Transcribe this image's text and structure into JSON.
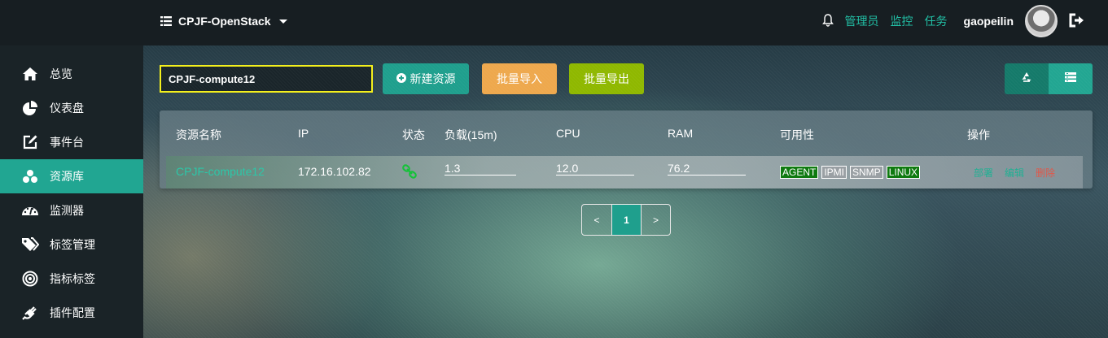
{
  "header": {
    "project_name": "CPJF-OpenStack",
    "links": [
      "管理员",
      "监控",
      "任务"
    ],
    "username": "gaopeilin"
  },
  "sidebar": {
    "items": [
      {
        "label": "总览",
        "icon": "home-icon"
      },
      {
        "label": "仪表盘",
        "icon": "pie-chart-icon"
      },
      {
        "label": "事件台",
        "icon": "edit-icon"
      },
      {
        "label": "资源库",
        "icon": "cubes-icon",
        "active": true
      },
      {
        "label": "监测器",
        "icon": "dashboard-icon"
      },
      {
        "label": "标签管理",
        "icon": "tags-icon"
      },
      {
        "label": "指标标签",
        "icon": "target-icon"
      },
      {
        "label": "插件配置",
        "icon": "plug-icon"
      }
    ]
  },
  "toolbar": {
    "search_value": "CPJF-compute12",
    "new_label": "新建资源",
    "import_label": "批量导入",
    "export_label": "批量导出",
    "icon_buttons": [
      "recycle-icon",
      "list-icon"
    ]
  },
  "table": {
    "headers": [
      "资源名称",
      "IP",
      "状态",
      "负载(15m)",
      "CPU",
      "RAM",
      "可用性",
      "操作"
    ],
    "rows": [
      {
        "name": "CPJF-compute12",
        "ip": "172.16.102.82",
        "status_icon": "link-icon",
        "load": "1.3",
        "cpu": "12.0",
        "ram": "76.2",
        "availability": [
          {
            "label": "AGENT",
            "ok": true
          },
          {
            "label": "IPMI",
            "ok": false
          },
          {
            "label": "SNMP",
            "ok": false
          },
          {
            "label": "LINUX",
            "ok": true
          }
        ],
        "actions": [
          "部署",
          "编辑",
          "删除"
        ]
      }
    ]
  },
  "pagination": {
    "prev": "<",
    "current": "1",
    "next": ">"
  },
  "colors": {
    "accent": "#21a692",
    "warning": "#eea84d",
    "success": "#8fb800",
    "highlight": "#f4f01a"
  }
}
